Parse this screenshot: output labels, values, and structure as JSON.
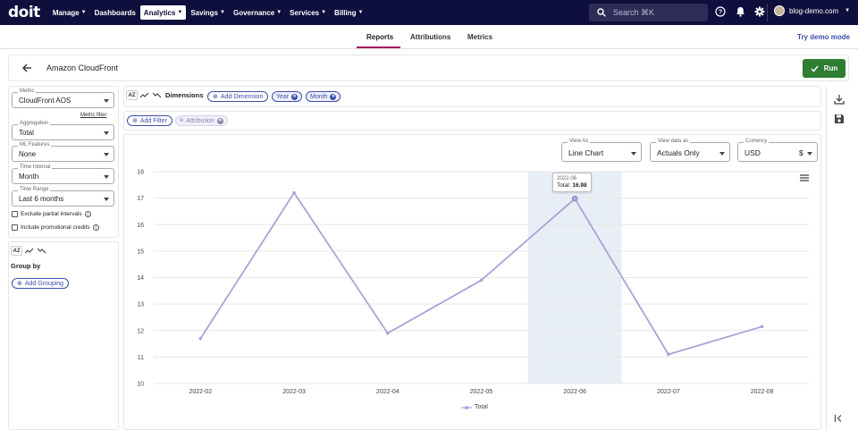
{
  "app": {
    "logo": "doit"
  },
  "nav": [
    {
      "label": "Manage",
      "caret": true,
      "active": false
    },
    {
      "label": "Dashboards",
      "caret": false,
      "active": false
    },
    {
      "label": "Analytics",
      "caret": true,
      "active": true
    },
    {
      "label": "Savings",
      "caret": true,
      "active": false
    },
    {
      "label": "Governance",
      "caret": true,
      "active": false
    },
    {
      "label": "Services",
      "caret": true,
      "active": false
    },
    {
      "label": "Billing",
      "caret": true,
      "active": false
    }
  ],
  "search": {
    "placeholder": "Search ⌘K"
  },
  "account": {
    "name": "blog-demo.com"
  },
  "tabs": {
    "reports": "Reports",
    "attributions": "Attributions",
    "metrics": "Metrics",
    "try_demo": "Try demo mode"
  },
  "report": {
    "title": "Amazon CloudFront",
    "run_label": "Run"
  },
  "sidebar": {
    "metric": {
      "label": "Metric",
      "value": "CloudFront AOS"
    },
    "metric_filter": "Metric filter",
    "aggregation": {
      "label": "Aggregation",
      "value": "Total"
    },
    "ml_features": {
      "label": "ML Features",
      "value": "None"
    },
    "time_interval": {
      "label": "Time Interval",
      "value": "Month"
    },
    "time_range": {
      "label": "Time Range",
      "value": "Last 6 months"
    },
    "exclude_partial": "Exclude partial intervals",
    "include_credits": "Include promotional credits",
    "group_by": "Group by",
    "add_grouping": "Add Grouping",
    "sort_icon_label": "AZ"
  },
  "dimensions": {
    "label": "Dimensions",
    "add_label": "Add Dimension",
    "chips": [
      "Year",
      "Month"
    ]
  },
  "filters": {
    "add_label": "Add Filter",
    "chips": [
      "Attribution"
    ]
  },
  "chart_controls": {
    "view_as": {
      "label": "View As",
      "value": "Line Chart"
    },
    "view_data_as": {
      "label": "View data as",
      "value": "Actuals Only"
    },
    "currency": {
      "label": "Currency",
      "value": "USD",
      "symbol": "$"
    }
  },
  "tooltip": {
    "date": "2022-06",
    "label": "Total:",
    "value": "16.98"
  },
  "colors": {
    "accent": "#a5195f",
    "series": "#a9a3d6",
    "highlight": "#e8eef6",
    "run": "#2e7d32",
    "nav_bg": "#0f0f3d"
  },
  "chart_data": {
    "type": "line",
    "x": [
      "2022-02",
      "2022-03",
      "2022-04",
      "2022-05",
      "2022-06",
      "2022-07",
      "2022-08"
    ],
    "series": [
      {
        "name": "Total",
        "values": [
          11.7,
          17.2,
          11.9,
          13.9,
          16.98,
          11.1,
          12.15
        ]
      }
    ],
    "ylim": [
      10,
      18
    ],
    "yticks": [
      10,
      11,
      12,
      13,
      14,
      15,
      16,
      17,
      18
    ],
    "highlight_category": "2022-06",
    "grid": true,
    "legend": "bottom-center"
  }
}
